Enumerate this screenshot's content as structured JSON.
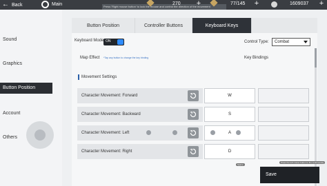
{
  "topbar": {
    "back_label": "Back",
    "main_label": "Main",
    "tip_text": "Press 'Right mouse button' to lock the mouse and control the direction of the movement",
    "stat1": "270",
    "stat2": "77/145",
    "stat3": "1609037"
  },
  "sidebar": {
    "items": [
      {
        "label": "Sound"
      },
      {
        "label": "Graphics"
      },
      {
        "label": "Button Position"
      },
      {
        "label": "Account"
      },
      {
        "label": "Others"
      }
    ]
  },
  "tabs": [
    {
      "label": "Button Position"
    },
    {
      "label": "Controller Buttons"
    },
    {
      "label": "Keyboard Keys"
    }
  ],
  "keyboard_mode": {
    "label": "Keyboard Mode",
    "toggle_text": "ON"
  },
  "control_type": {
    "label": "Control Type:",
    "value": "Combat"
  },
  "map_effect": {
    "label": "Map Effect",
    "note": "*Tap any button to change the key binding"
  },
  "key_bindings_label": "Key Bindings",
  "section_title": "Movement Settings",
  "movements": [
    {
      "label": "Character Movement: Forward",
      "key1": "W",
      "key2": ""
    },
    {
      "label": "Character Movement: Backward",
      "key1": "S",
      "key2": ""
    },
    {
      "label": "Character Movement: Left",
      "key1": "A",
      "key2": ""
    },
    {
      "label": "Character Movement: Right",
      "key1": "D",
      "key2": ""
    }
  ],
  "badges": {
    "space": "Space",
    "hint": "Press the left mouse button to fire continuously"
  },
  "save_label": "Save"
}
